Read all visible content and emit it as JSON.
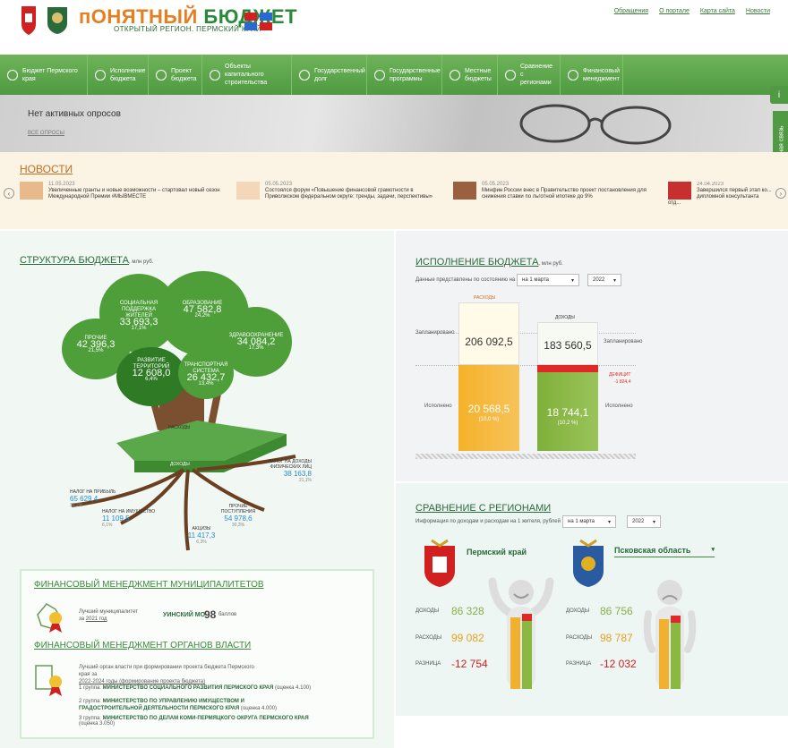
{
  "header": {
    "logo_title_a": "пОНЯТНЫЙ",
    "logo_title_b": "БЮДЖЕТ",
    "logo_subtitle": "ОТКРЫТЫЙ РЕГИОН. ПЕРМСКИЙ КРАЙ",
    "links": [
      "Обращения",
      "О портале",
      "Карта сайта",
      "Новости"
    ]
  },
  "nav": [
    {
      "label": "Бюджет Пермского края",
      "icon": "coins-icon"
    },
    {
      "label": "Исполнение бюджета",
      "icon": "chart-line-icon"
    },
    {
      "label": "Проект бюджета",
      "icon": "pie-chart-icon"
    },
    {
      "label": "Объекты капитального строительства",
      "icon": "building-icon"
    },
    {
      "label": "Государственный долг",
      "icon": "debt-icon"
    },
    {
      "label": "Государственные программы",
      "icon": "gear-icon"
    },
    {
      "label": "Местные бюджеты",
      "icon": "document-icon"
    },
    {
      "label": "Сравнение с регионами",
      "icon": "compare-icon"
    },
    {
      "label": "Финансовый менеджмент",
      "icon": "person-icon"
    }
  ],
  "banner": {
    "title": "Нет активных опросов",
    "link": "ВСЕ ОПРОСЫ"
  },
  "side": {
    "feedback": "Обратная связь",
    "info": "i"
  },
  "news": {
    "title": "НОВОСТИ",
    "items": [
      {
        "date": "11.05.2023",
        "text": "Увеличенные гранты и новые возможности – стартовал новый сезон Международной Премии #МЫВМЕСТЕ"
      },
      {
        "date": "05.05.2023",
        "text": "Состоялся форум «Повышение финансовой грамотности в Приволжском федеральном округе: тренды, задачи, перспективы»"
      },
      {
        "date": "05.05.2023",
        "text": "Минфин России внес в Правительство проект постановления для снижения ставки по льготной ипотеке до 9%"
      },
      {
        "date": "24.04.2023",
        "text": "Завершился первый этап ко... дипломной консультанта отд..."
      }
    ]
  },
  "structure": {
    "title": "СТРУКТУРА БЮДЖЕТА",
    "unit": ", млн руб.",
    "leaves": [
      {
        "label": "СОЦИАЛЬНАЯ ПОДДЕРЖКА ЖИТЕЛЕЙ",
        "value": "33 693,3",
        "pct": "17,1%"
      },
      {
        "label": "ОБРАЗОВАНИЕ",
        "value": "47 582,8",
        "pct": "24,2%"
      },
      {
        "label": "ПРОЧИЕ",
        "value": "42 396,3",
        "pct": "21,5%"
      },
      {
        "label": "ЗДРАВООХРАНЕНИЕ",
        "value": "34 084,2",
        "pct": "17,3%"
      },
      {
        "label": "РАЗВИТИЕ ТЕРРИТОРИЙ",
        "value": "12 608,0",
        "pct": "6,4%"
      },
      {
        "label": "ТРАНСПОРТНАЯ СИСТЕМА",
        "value": "26 432,7",
        "pct": "13,4%"
      }
    ],
    "trunk_label": "РАСХОДЫ",
    "ground_label": "ДОХОДЫ",
    "roots": [
      {
        "label": "НАЛОГ НА ДОХОДЫ ФИЗИЧЕСКИХ ЛИЦ",
        "value": "38 163,8",
        "pct": "21,1%"
      },
      {
        "label": "НАЛОГ НА ПРИБЫЛЬ",
        "value": "65 629,4",
        "pct": "36,2%"
      },
      {
        "label": "НАЛОГ НА ИМУЩЕСТВО",
        "value": "11 109,5",
        "pct": "6,1%"
      },
      {
        "label": "ПРОЧИЕ ПОСТУПЛЕНИЯ",
        "value": "54 978,6",
        "pct": "30,3%"
      },
      {
        "label": "АКЦИЗЫ",
        "value": "11 417,3",
        "pct": "6,3%"
      }
    ]
  },
  "finmgmt": {
    "mun_title": "ФИНАНСОВЫЙ МЕНЕДЖМЕНТ МУНИЦИПАЛИТЕТОВ",
    "mun_best": "Лучший муниципалитет",
    "mun_year_pre": "за",
    "mun_year": "2021 год",
    "mun_name": "УИНСКИЙ МО",
    "mun_score": "98",
    "mun_score_unit": "баллов",
    "org_title": "ФИНАНСОВЫЙ МЕНЕДЖМЕНТ ОРГАНОВ ВЛАСТИ",
    "org_best": "Лучший орган власти при формировании проекта бюджета Пермского края за",
    "org_period": "2022-2024 годы (формирование проекта бюджета)",
    "groups": [
      {
        "prefix": "1 группа:",
        "name": "МИНИСТЕРСТВО СОЦИАЛЬНОГО РАЗВИТИЯ ПЕРМСКОГО КРАЯ",
        "score": "(оценка 4.100)"
      },
      {
        "prefix": "2 группа:",
        "name": "МИНИСТЕРСТВО ПО УПРАВЛЕНИЮ ИМУЩЕСТВОМ И ГРАДОСТРОИТЕЛЬНОЙ ДЕЯТЕЛЬНОСТИ ПЕРМСКОГО КРАЯ",
        "score": "(оценка 4.000)"
      },
      {
        "prefix": "3 группа:",
        "name": "МИНИСТЕРСТВО ПО ДЕЛАМ КОМИ-ПЕРМЯЦКОГО ОКРУГА ПЕРМСКОГО КРАЯ",
        "score": "(оценка 3.050)"
      }
    ]
  },
  "execution": {
    "title": "ИСПОЛНЕНИЕ БЮДЖЕТА",
    "unit": ", млн руб.",
    "state_label": "Данные представлены по состоянию на",
    "date_select": "на 1 марта",
    "year_select": "2022",
    "expenses_label": "РАСХОДЫ",
    "incomes_label": "ДОХОДЫ",
    "planned_label": "Запланировано",
    "executed_label": "Исполнено",
    "expenses_planned": "206 092,5",
    "expenses_exec": "20 568,5",
    "expenses_pct": "(10,0 %)",
    "incomes_planned": "183 560,5",
    "incomes_exec": "18 744,1",
    "incomes_pct": "(10,2 %)",
    "deficit_label": "ДЕФИЦИТ",
    "deficit_value": "-1 824,4",
    "accent_expense": "#f0b030",
    "accent_income": "#8ab840",
    "accent_deficit": "#e02828"
  },
  "regions": {
    "title": "СРАВНЕНИЕ С РЕГИОНАМИ",
    "info": "Информация по доходам и расходам на 1 жителя, рублей",
    "date_select": "на 1 марта",
    "year_select": "2022",
    "rows": [
      "ДОХОДЫ",
      "РАСХОДЫ",
      "РАЗНИЦА"
    ],
    "left": {
      "name": "Пермский край",
      "income": "86 328",
      "expense": "99 082",
      "diff": "-12 754"
    },
    "right": {
      "name": "Псковская область",
      "income": "86 756",
      "expense": "98 787",
      "diff": "-12 032"
    }
  }
}
